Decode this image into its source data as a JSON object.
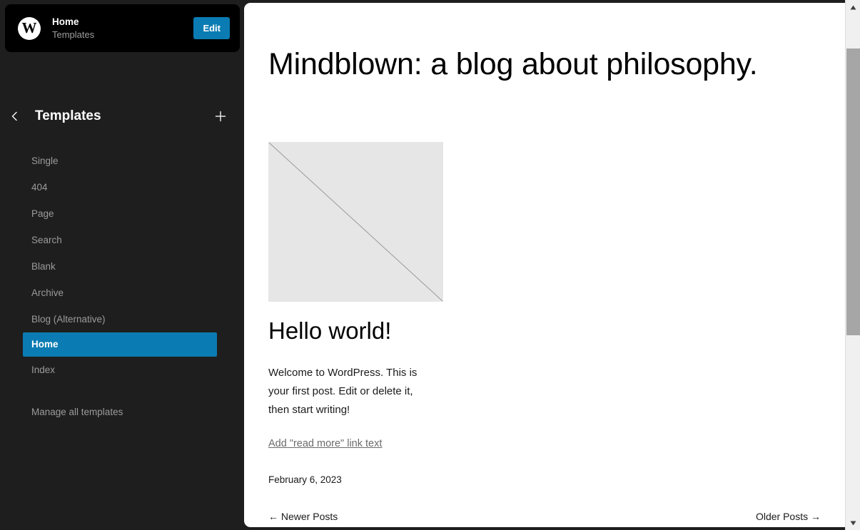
{
  "site_card": {
    "logo_icon": "wordpress-logo-icon",
    "logo_glyph": "W",
    "title": "Home",
    "subtitle": "Templates",
    "edit_label": "Edit",
    "accent_color": "#0b7cb3",
    "background_color": "#000000"
  },
  "panel": {
    "back_icon": "chevron-left-icon",
    "title": "Templates",
    "add_icon": "plus-icon",
    "background_color": "#1e1e1e",
    "selected_color": "#0b7cb3",
    "items": [
      {
        "label": "Single",
        "selected": false
      },
      {
        "label": "404",
        "selected": false
      },
      {
        "label": "Page",
        "selected": false
      },
      {
        "label": "Search",
        "selected": false
      },
      {
        "label": "Blank",
        "selected": false
      },
      {
        "label": "Archive",
        "selected": false
      },
      {
        "label": "Blog (Alternative)",
        "selected": false
      },
      {
        "label": "Home",
        "selected": true
      },
      {
        "label": "Index",
        "selected": false
      }
    ],
    "manage_label": "Manage all templates"
  },
  "canvas": {
    "blog_title": "Mindblown: a blog about philosophy.",
    "post": {
      "image_icon": "broken-image-placeholder-icon",
      "title": "Hello world!",
      "excerpt": "Welcome to WordPress. This is your first post. Edit or delete it, then start writing!",
      "read_more_label": "Add \"read more\" link text",
      "date": "February 6, 2023"
    },
    "pagination": {
      "newer_label": "← Newer Posts",
      "older_label": "Older Posts →"
    }
  },
  "scrollbar": {
    "up_icon": "scroll-up-arrow-icon",
    "down_icon": "scroll-down-arrow-icon",
    "thumb_name": "scrollbar-thumb"
  }
}
